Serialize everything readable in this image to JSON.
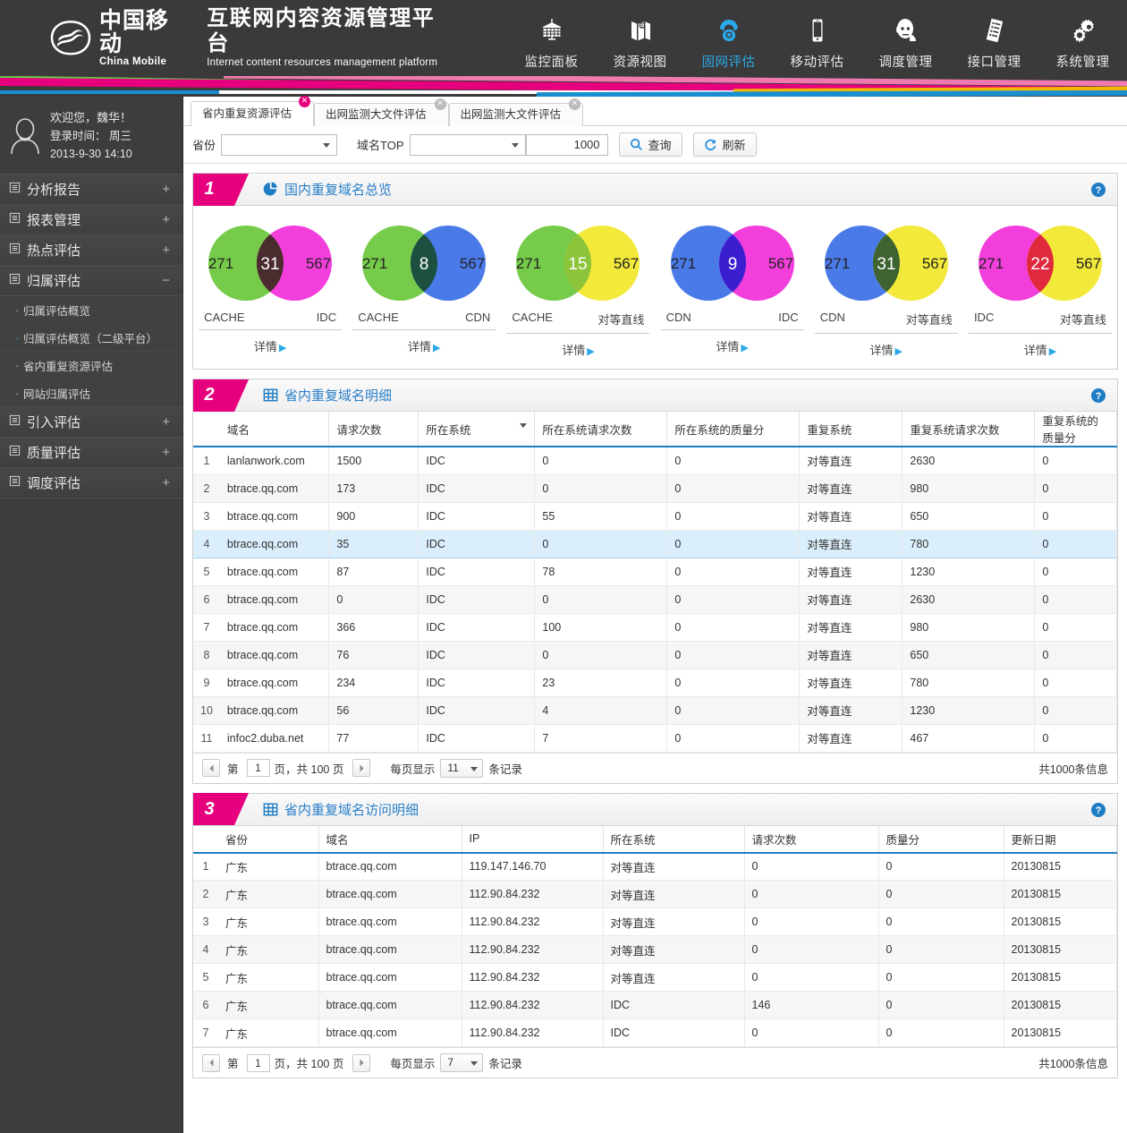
{
  "brand": {
    "company_cn": "中国移动",
    "company_en": "China Mobile",
    "platform_cn": "互联网内容资源管理平台",
    "platform_en": "Internet content resources management platform",
    "accent": "#e6007e",
    "link_blue": "#2aa8e8"
  },
  "topnav": [
    {
      "label": "监控面板",
      "icon": "dashboard-icon",
      "active": false
    },
    {
      "label": "资源视图",
      "icon": "map-pin-icon",
      "active": false
    },
    {
      "label": "固网评估",
      "icon": "telephone-icon",
      "active": true
    },
    {
      "label": "移动评估",
      "icon": "mobile-phone-icon",
      "active": false
    },
    {
      "label": "调度管理",
      "icon": "headset-icon",
      "active": false
    },
    {
      "label": "接口管理",
      "icon": "document-list-icon",
      "active": false
    },
    {
      "label": "系统管理",
      "icon": "gears-icon",
      "active": false
    }
  ],
  "sidebar": {
    "user": {
      "welcome": "欢迎您，魏华！",
      "login_label": "登录时间： 周三",
      "login_time": "2013-9-30  14:10",
      "avatar_icon": "user-avatar-icon"
    },
    "groups": [
      {
        "label": "分析报告",
        "toggle": "+",
        "expanded": false
      },
      {
        "label": "报表管理",
        "toggle": "+",
        "expanded": false
      },
      {
        "label": "热点评估",
        "toggle": "+",
        "expanded": false
      },
      {
        "label": "归属评估",
        "toggle": "−",
        "expanded": true,
        "items": [
          {
            "label": "归属评估概览",
            "highlight": false
          },
          {
            "label": "归属评估概览（二级平台）",
            "highlight": true
          },
          {
            "label": "省内重复资源评估",
            "highlight": false
          },
          {
            "label": "网站归属评估",
            "highlight": false
          }
        ]
      },
      {
        "label": "引入评估",
        "toggle": "+",
        "expanded": false
      },
      {
        "label": "质量评估",
        "toggle": "+",
        "expanded": false
      },
      {
        "label": "调度评估",
        "toggle": "+",
        "expanded": false
      }
    ]
  },
  "tabs": [
    {
      "label": "省内重复资源评估",
      "active": true,
      "close": "✕"
    },
    {
      "label": "出网监测大文件评估",
      "active": false,
      "close": "✕"
    },
    {
      "label": "出网监测大文件评估",
      "active": false,
      "close": "✕"
    }
  ],
  "filter": {
    "province_label": "省份",
    "province_value": "",
    "domain_top_label": "域名TOP",
    "domain_top_value": "",
    "count_value": "1000",
    "query_button": "查询",
    "refresh_button": "刷新",
    "search_icon": "search-icon",
    "refresh_icon": "refresh-icon"
  },
  "panel1": {
    "number": "1",
    "title": "国内重复域名总览",
    "icon": "pie-chart-icon",
    "help_icon": "help-icon",
    "detail_label": "详情"
  },
  "chart_data": {
    "type": "venn",
    "title": "国内重复域名总览",
    "diagrams": [
      {
        "left_label": "CACHE",
        "right_label": "IDC",
        "left_value": "271",
        "right_value": "567",
        "overlap_value": "31",
        "left_color": "#76cc4a",
        "right_color": "#f23fdc",
        "overlap_color": "#4a2c2e",
        "overlap_text": "#ffffff"
      },
      {
        "left_label": "CACHE",
        "right_label": "CDN",
        "left_value": "271",
        "right_value": "567",
        "overlap_value": "8",
        "left_color": "#76cc4a",
        "right_color": "#4a7ae8",
        "overlap_color": "#1d5040",
        "overlap_text": "#ffffff"
      },
      {
        "left_label": "CACHE",
        "right_label": "对等直线",
        "left_value": "271",
        "right_value": "567",
        "overlap_value": "15",
        "left_color": "#76cc4a",
        "right_color": "#f2e93a",
        "overlap_color": "#8cc43a",
        "overlap_text": "#ffffff"
      },
      {
        "left_label": "CDN",
        "right_label": "IDC",
        "left_value": "271",
        "right_value": "567",
        "overlap_value": "9",
        "left_color": "#4a7ae8",
        "right_color": "#f23fdc",
        "overlap_color": "#3a1fd0",
        "overlap_text": "#ffffff"
      },
      {
        "left_label": "CDN",
        "right_label": "对等直线",
        "left_value": "271",
        "right_value": "567",
        "overlap_value": "31",
        "left_color": "#4a7ae8",
        "right_color": "#f2e93a",
        "overlap_color": "#3e6331",
        "overlap_text": "#ffffff"
      },
      {
        "left_label": "IDC",
        "right_label": "对等直线",
        "left_value": "271",
        "right_value": "567",
        "overlap_value": "22",
        "left_color": "#f23fdc",
        "right_color": "#f2e93a",
        "overlap_color": "#e0293d",
        "overlap_text": "#ffffff"
      }
    ]
  },
  "panel2": {
    "number": "2",
    "title": "省内重复域名明细",
    "icon": "table-grid-icon",
    "help_icon": "help-icon",
    "columns": [
      "域名",
      "请求次数",
      "所在系统",
      "所在系统请求次数",
      "所在系统的质量分",
      "重复系统",
      "重复系统请求次数",
      "重复系统的质量分"
    ],
    "sorted_column_index": 2,
    "rows": [
      {
        "idx": "1",
        "cells": [
          "lanlanwork.com",
          "1500",
          "IDC",
          "0",
          "0",
          "对等直连",
          "2630",
          "0"
        ]
      },
      {
        "idx": "2",
        "cells": [
          "btrace.qq.com",
          "173",
          "IDC",
          "0",
          "0",
          "对等直连",
          "980",
          "0"
        ]
      },
      {
        "idx": "3",
        "cells": [
          "btrace.qq.com",
          "900",
          "IDC",
          "55",
          "0",
          "对等直连",
          "650",
          "0"
        ]
      },
      {
        "idx": "4",
        "cells": [
          "btrace.qq.com",
          "35",
          "IDC",
          "0",
          "0",
          "对等直连",
          "780",
          "0"
        ],
        "selected": true
      },
      {
        "idx": "5",
        "cells": [
          "btrace.qq.com",
          "87",
          "IDC",
          "78",
          "0",
          "对等直连",
          "1230",
          "0"
        ]
      },
      {
        "idx": "6",
        "cells": [
          "btrace.qq.com",
          "0",
          "IDC",
          "0",
          "0",
          "对等直连",
          "2630",
          "0"
        ]
      },
      {
        "idx": "7",
        "cells": [
          "btrace.qq.com",
          "366",
          "IDC",
          "100",
          "0",
          "对等直连",
          "980",
          "0"
        ]
      },
      {
        "idx": "8",
        "cells": [
          "btrace.qq.com",
          "76",
          "IDC",
          "0",
          "0",
          "对等直连",
          "650",
          "0"
        ]
      },
      {
        "idx": "9",
        "cells": [
          "btrace.qq.com",
          "234",
          "IDC",
          "23",
          "0",
          "对等直连",
          "780",
          "0"
        ]
      },
      {
        "idx": "10",
        "cells": [
          "btrace.qq.com",
          "56",
          "IDC",
          "4",
          "0",
          "对等直连",
          "1230",
          "0"
        ]
      },
      {
        "idx": "11",
        "cells": [
          "infoc2.duba.net",
          "77",
          "IDC",
          "7",
          "0",
          "对等直连",
          "467",
          "0"
        ]
      }
    ],
    "pager": {
      "prev_icon": "chevron-left-icon",
      "next_icon": "chevron-right-icon",
      "page_prefix": "第",
      "page_value": "1",
      "page_suffix": "页，共 100 页",
      "size_label": "每页显示",
      "size_value": "11",
      "size_suffix": "条记录",
      "total": "共1000条信息"
    }
  },
  "panel3": {
    "number": "3",
    "title": "省内重复域名访问明细",
    "icon": "table-grid-icon",
    "help_icon": "help-icon",
    "columns": [
      "省份",
      "域名",
      "IP",
      "所在系统",
      "请求次数",
      "质量分",
      "更新日期"
    ],
    "rows": [
      {
        "idx": "1",
        "cells": [
          "广东",
          "btrace.qq.com",
          "119.147.146.70",
          "对等直连",
          "0",
          "0",
          "20130815"
        ]
      },
      {
        "idx": "2",
        "cells": [
          "广东",
          "btrace.qq.com",
          "112.90.84.232",
          "对等直连",
          "0",
          "0",
          "20130815"
        ]
      },
      {
        "idx": "3",
        "cells": [
          "广东",
          "btrace.qq.com",
          "112.90.84.232",
          "对等直连",
          "0",
          "0",
          "20130815"
        ]
      },
      {
        "idx": "4",
        "cells": [
          "广东",
          "btrace.qq.com",
          "112.90.84.232",
          "对等直连",
          "0",
          "0",
          "20130815"
        ]
      },
      {
        "idx": "5",
        "cells": [
          "广东",
          "btrace.qq.com",
          "112.90.84.232",
          "对等直连",
          "0",
          "0",
          "20130815"
        ]
      },
      {
        "idx": "6",
        "cells": [
          "广东",
          "btrace.qq.com",
          "112.90.84.232",
          "IDC",
          "146",
          "0",
          "20130815"
        ]
      },
      {
        "idx": "7",
        "cells": [
          "广东",
          "btrace.qq.com",
          "112.90.84.232",
          "IDC",
          "0",
          "0",
          "20130815"
        ]
      }
    ],
    "pager": {
      "prev_icon": "chevron-left-icon",
      "next_icon": "chevron-right-icon",
      "page_prefix": "第",
      "page_value": "1",
      "page_suffix": "页，共 100 页",
      "size_label": "每页显示",
      "size_value": "7",
      "size_suffix": "条记录",
      "total": "共1000条信息"
    }
  }
}
